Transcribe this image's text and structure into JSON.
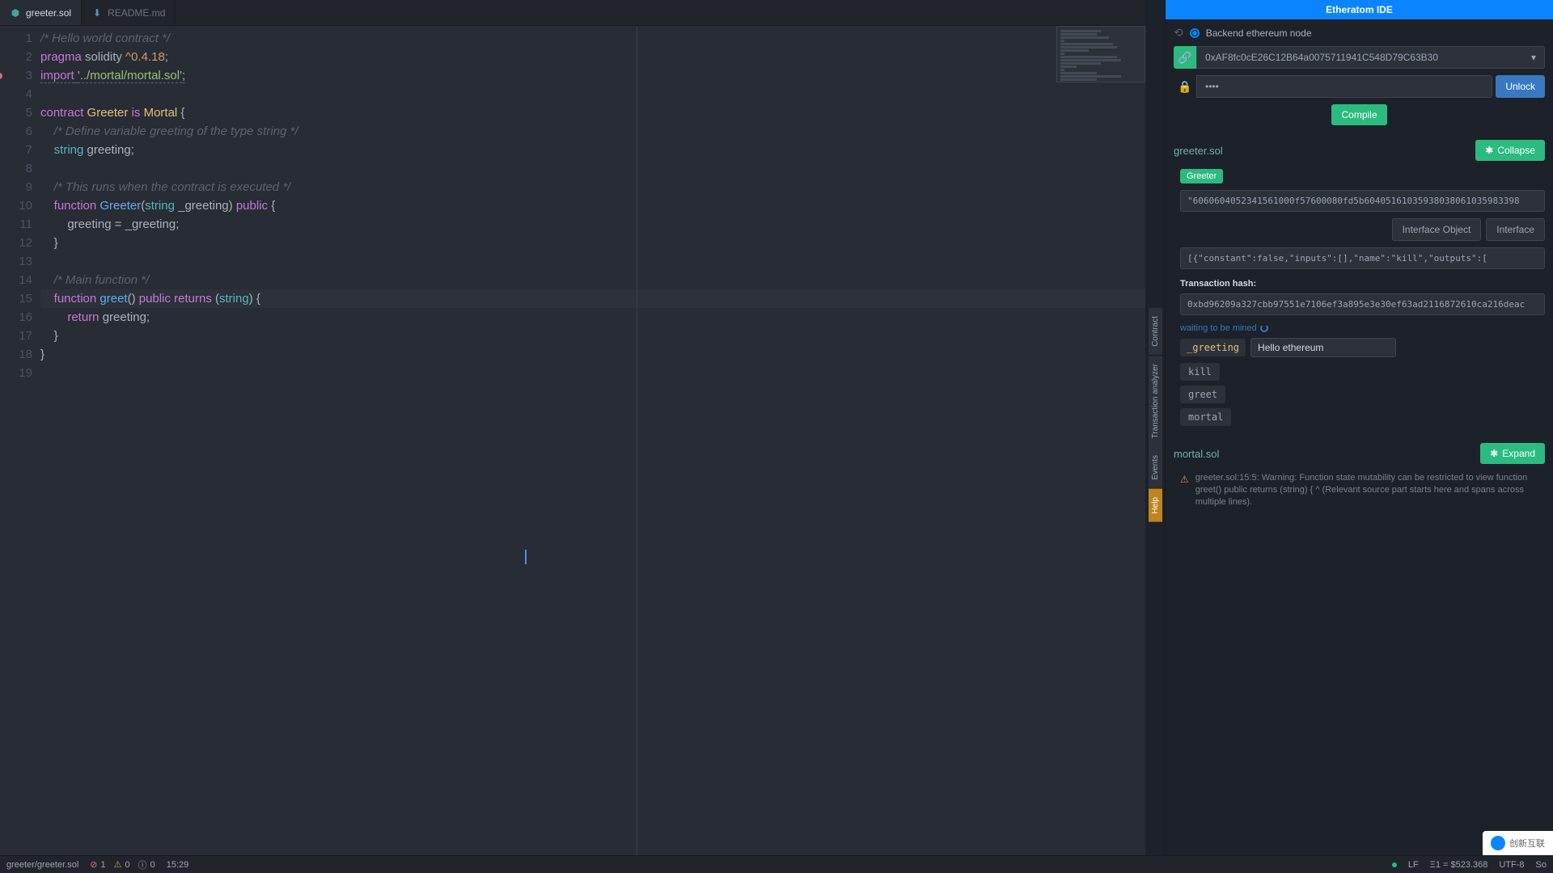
{
  "tabs": [
    {
      "name": "greeter.sol",
      "icon": "sol",
      "active": true
    },
    {
      "name": "README.md",
      "icon": "md",
      "active": false
    }
  ],
  "editor": {
    "breakpoint_line": 3,
    "current_line": 15
  },
  "code_lines": [
    [
      {
        "t": "/* Hello world contract */",
        "c": "hl-comment"
      }
    ],
    [
      {
        "t": "pragma",
        "c": "hl-keyword"
      },
      {
        "t": " solidity ",
        "c": "hl-text"
      },
      {
        "t": "^0.4.18",
        "c": "hl-version"
      },
      {
        "t": ";",
        "c": "hl-punct"
      }
    ],
    [
      {
        "t": "import",
        "c": "hl-keyword import-under"
      },
      {
        "t": " ",
        "c": "hl-text import-under"
      },
      {
        "t": "'../mortal/mortal.sol'",
        "c": "hl-string import-under"
      },
      {
        "t": ";",
        "c": "hl-punct import-under"
      }
    ],
    [],
    [
      {
        "t": "contract",
        "c": "hl-keyword"
      },
      {
        "t": " ",
        "c": "hl-text"
      },
      {
        "t": "Greeter",
        "c": "hl-classname"
      },
      {
        "t": " ",
        "c": "hl-text"
      },
      {
        "t": "is",
        "c": "hl-keyword"
      },
      {
        "t": " ",
        "c": "hl-text"
      },
      {
        "t": "Mortal",
        "c": "hl-classname"
      },
      {
        "t": " {",
        "c": "hl-punct"
      }
    ],
    [
      {
        "t": "    ",
        "c": "hl-text"
      },
      {
        "t": "/* Define variable greeting of the type string */",
        "c": "hl-comment"
      }
    ],
    [
      {
        "t": "    ",
        "c": "hl-text"
      },
      {
        "t": "string",
        "c": "hl-builtin"
      },
      {
        "t": " greeting;",
        "c": "hl-text"
      }
    ],
    [],
    [
      {
        "t": "    ",
        "c": "hl-text"
      },
      {
        "t": "/* This runs when the contract is executed */",
        "c": "hl-comment"
      }
    ],
    [
      {
        "t": "    ",
        "c": "hl-text"
      },
      {
        "t": "function",
        "c": "hl-keyword"
      },
      {
        "t": " ",
        "c": "hl-text"
      },
      {
        "t": "Greeter",
        "c": "hl-fn"
      },
      {
        "t": "(",
        "c": "hl-punct"
      },
      {
        "t": "string",
        "c": "hl-builtin"
      },
      {
        "t": " _greeting) ",
        "c": "hl-text"
      },
      {
        "t": "public",
        "c": "hl-keyword"
      },
      {
        "t": " {",
        "c": "hl-punct"
      }
    ],
    [
      {
        "t": "        greeting = _greeting;",
        "c": "hl-text"
      }
    ],
    [
      {
        "t": "    }",
        "c": "hl-text"
      }
    ],
    [],
    [
      {
        "t": "    ",
        "c": "hl-text"
      },
      {
        "t": "/* Main function */",
        "c": "hl-comment"
      }
    ],
    [
      {
        "t": "    ",
        "c": "hl-text"
      },
      {
        "t": "function",
        "c": "hl-keyword"
      },
      {
        "t": " ",
        "c": "hl-text"
      },
      {
        "t": "greet",
        "c": "hl-fn"
      },
      {
        "t": "() ",
        "c": "hl-punct"
      },
      {
        "t": "public",
        "c": "hl-keyword"
      },
      {
        "t": " ",
        "c": "hl-text"
      },
      {
        "t": "returns",
        "c": "hl-keyword"
      },
      {
        "t": " (",
        "c": "hl-punct"
      },
      {
        "t": "string",
        "c": "hl-builtin"
      },
      {
        "t": ") {",
        "c": "hl-punct"
      }
    ],
    [
      {
        "t": "        ",
        "c": "hl-text"
      },
      {
        "t": "return",
        "c": "hl-keyword"
      },
      {
        "t": " greeting;",
        "c": "hl-text"
      }
    ],
    [
      {
        "t": "    }",
        "c": "hl-text"
      }
    ],
    [
      {
        "t": "}",
        "c": "hl-text"
      }
    ],
    []
  ],
  "side_tabs": [
    {
      "label": "Contract"
    },
    {
      "label": "Transaction analyzer",
      "marker": "red"
    },
    {
      "label": "Events"
    },
    {
      "label": "Help",
      "marker": "orange"
    }
  ],
  "panel": {
    "title": "Etheratom IDE",
    "node_label": "Backend ethereum node",
    "address": "0xAF8fc0cE26C12B64a0075711941C548D79C63B30",
    "password_display": "••••",
    "unlock_btn": "Unlock",
    "compile_btn": "Compile",
    "file1": {
      "name": "greeter.sol",
      "collapse_btn": "Collapse",
      "contract_badge": "Greeter",
      "bytecode": "\"6060604052341561000f57600080fd5b60405161035938038061035983398",
      "interface_obj_btn": "Interface Object",
      "interface_btn": "Interface",
      "abi": "[{\"constant\":false,\"inputs\":[],\"name\":\"kill\",\"outputs\":[",
      "tx_label": "Transaction hash:",
      "tx_hash": "0xbd96209a327cbb97551e7106ef3a895e3e30ef63ad2116872610ca216deac",
      "mining_status": "waiting to be mined",
      "greeting_param": "_greeting",
      "greeting_value": "Hello ethereum",
      "fns": [
        "kill",
        "greet",
        "mortal"
      ]
    },
    "file2": {
      "name": "mortal.sol",
      "expand_btn": "Expand",
      "warning": "greeter.sol:15:5: Warning: Function state mutability can be restricted to view function greet() public returns (string) { ^ (Relevant source part starts here and spans across multiple lines)."
    }
  },
  "status_bar": {
    "file_path": "greeter/greeter.sol",
    "errors": "1",
    "warnings": "0",
    "info": "0",
    "cursor_pos": "15:29",
    "line_ending": "LF",
    "eth_balance": "Ξ1 = $523.368",
    "encoding": "UTF-8",
    "lang_prefix": "So"
  },
  "watermark": "创新互联"
}
